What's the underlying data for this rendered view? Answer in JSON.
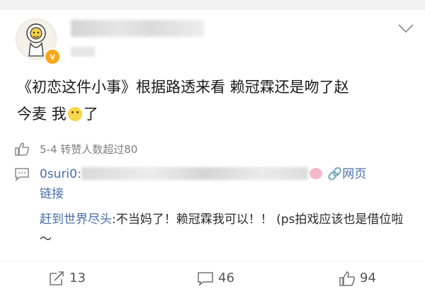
{
  "post": {
    "text_line1": "《初恋这件小事》根据路透来看 赖冠霖还是吻了赵",
    "text_line2_a": "今麦 我",
    "text_line2_emoji": "hungry-emoji",
    "text_line2_b": "了"
  },
  "meta": {
    "text": "5-4 转赞人数超过80"
  },
  "comments": [
    {
      "user": "0suri0:",
      "source_label": "网页",
      "source_wrap": "链接"
    },
    {
      "user": "赶到世界尽头",
      "text": ":不当妈了！赖冠霖我可以！！ (ps拍戏应该也是借位啦～"
    }
  ],
  "actions": {
    "repost_count": "13",
    "comment_count": "46",
    "like_count": "94"
  },
  "colors": {
    "link": "#4a6ea8",
    "badge": "#f7a81b"
  }
}
